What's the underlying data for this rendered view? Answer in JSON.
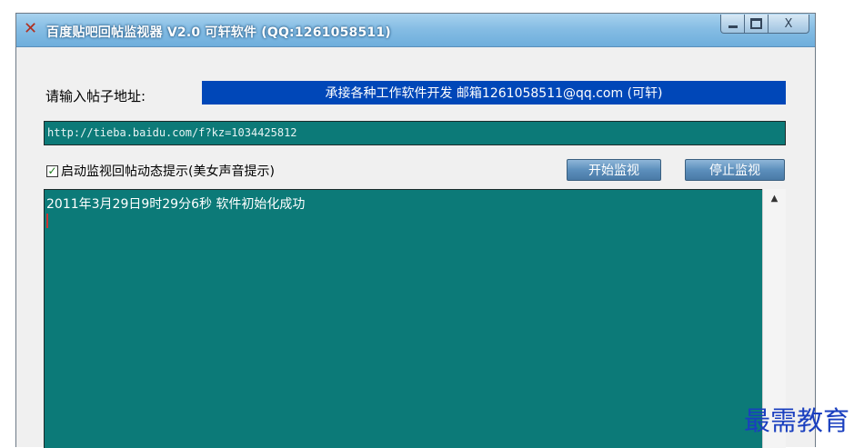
{
  "window": {
    "icon": "tool-icon",
    "title": "百度贴吧回帖监视器 V2.0  可轩软件  (QQ:1261058511)",
    "caption_buttons": [
      "minimize-icon",
      "maximize-icon",
      "close-icon"
    ],
    "close_glyph": "X"
  },
  "form": {
    "url_label": "请输入帖子地址:",
    "banner": "承接各种工作软件开发 邮箱1261058511@qq.com (可轩)",
    "url_value": "http://tieba.baidu.com/f?kz=1034425812",
    "checkbox": {
      "checked": true,
      "label": "启动监视回帖动态提示(美女声音提示)"
    },
    "start_button": "开始监视",
    "stop_button": "停止监视"
  },
  "log": {
    "lines": [
      "2011年3月29日9时29分6秒   软件初始化成功"
    ]
  },
  "scrollbar": {
    "up_glyph": "▲"
  },
  "watermark": "最需教育",
  "colors": {
    "titlebar": "#86bde4",
    "banner": "#0047b8",
    "teal_field": "#0c7a78",
    "button": "#5c8fbc"
  }
}
